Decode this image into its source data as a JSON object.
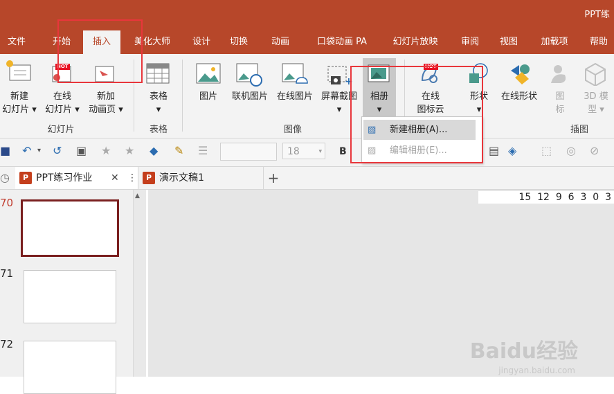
{
  "title": "PPT练",
  "tabs": [
    "文件",
    "开始",
    "插入",
    "美化大师",
    "设计",
    "切换",
    "动画",
    "口袋动画 PA",
    "幻灯片放映",
    "审阅",
    "视图",
    "加载项",
    "帮助"
  ],
  "ribbon": {
    "new_slide": [
      "新建",
      "幻灯片"
    ],
    "online_slide": [
      "在线",
      "幻灯片"
    ],
    "new_anim_page": [
      "新加",
      "动画页"
    ],
    "table": "表格",
    "picture": "图片",
    "online_pic_lib": "联机图片",
    "online_pic": "在线图片",
    "screenshot": "屏幕截图",
    "album": "相册",
    "online_icons": [
      "在线",
      "图标云"
    ],
    "shapes": "形状",
    "online_shapes": "在线形状",
    "icons": [
      "图",
      "标"
    ],
    "model3d": [
      "3D 模",
      "型"
    ],
    "hot_badge": "HOT",
    "groups": {
      "slides": "幻灯片",
      "tables": "表格",
      "images": "图像",
      "illustrations": "插图"
    }
  },
  "dropdown": {
    "new_album": "新建相册(A)...",
    "edit_album": "编辑相册(E)..."
  },
  "qat": {
    "font_size": "18",
    "bold": "B"
  },
  "doc_tabs": {
    "tab1": "PPT练习作业",
    "tab2": "演示文稿1",
    "close": "✕",
    "more": "⋮",
    "add": "+"
  },
  "ruler": "15  12  9  6  3  0  3",
  "slides": [
    "70",
    "71",
    "72"
  ],
  "watermark": {
    "logo": "Baidu经验",
    "url": "jingyan.baidu.com"
  },
  "colors": {
    "accent": "#b7472a",
    "highlight": "#e8363b"
  }
}
